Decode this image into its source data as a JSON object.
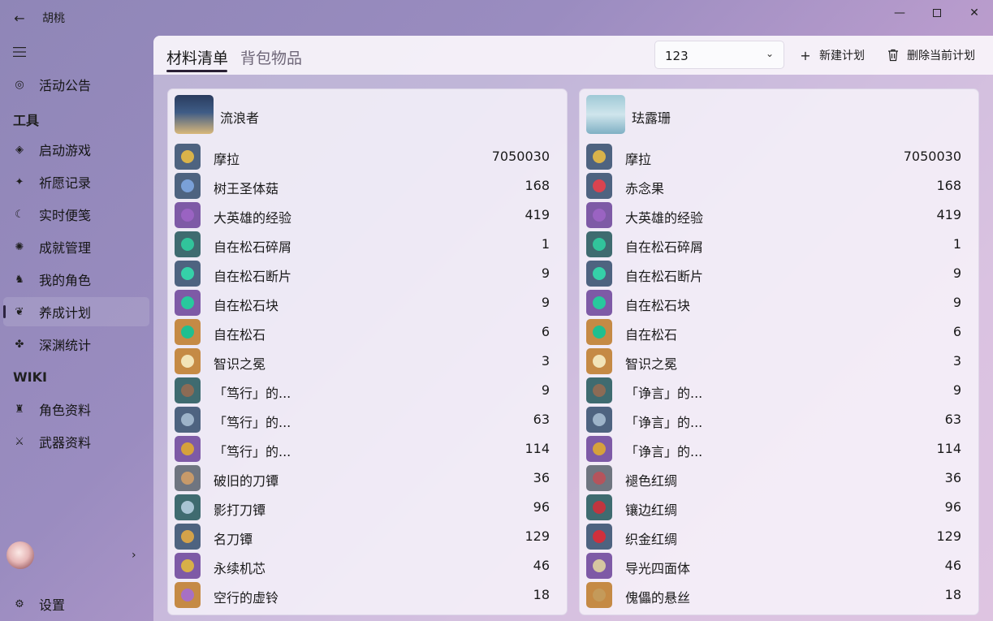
{
  "window": {
    "title": "胡桃"
  },
  "sidebar": {
    "items": [
      {
        "id": "announcement",
        "label": "活动公告",
        "icon": "announcement-icon",
        "glyph": "◎"
      },
      {
        "id": "launch",
        "label": "启动游戏",
        "icon": "launch-game-icon",
        "glyph": "◈"
      },
      {
        "id": "wish",
        "label": "祈愿记录",
        "icon": "wish-icon",
        "glyph": "✦"
      },
      {
        "id": "notes",
        "label": "实时便笺",
        "icon": "moon-icon",
        "glyph": "☾"
      },
      {
        "id": "achievement",
        "label": "成就管理",
        "icon": "achievement-icon",
        "glyph": "✺"
      },
      {
        "id": "avatars",
        "label": "我的角色",
        "icon": "avatar-icon",
        "glyph": "♞"
      },
      {
        "id": "cultivation",
        "label": "养成计划",
        "icon": "cultivation-icon",
        "glyph": "❦"
      },
      {
        "id": "abyss",
        "label": "深渊统计",
        "icon": "abyss-icon",
        "glyph": "✤"
      },
      {
        "id": "wiki-avatar",
        "label": "角色资料",
        "icon": "wiki-avatar-icon",
        "glyph": "♜"
      },
      {
        "id": "wiki-weapon",
        "label": "武器资料",
        "icon": "weapon-icon",
        "glyph": "⚔"
      }
    ],
    "headers": {
      "tools": "工具",
      "wiki": "WIKI"
    },
    "settings_label": "设置",
    "active": "cultivation"
  },
  "tabs": [
    {
      "label": "材料清单",
      "active": true
    },
    {
      "label": "背包物品",
      "active": false
    }
  ],
  "plan_select": {
    "value": "123"
  },
  "commands": {
    "new_plan": "新建计划",
    "delete_plan": "删除当前计划"
  },
  "cards": [
    {
      "character": "流浪者",
      "materials": [
        {
          "name": "摩拉",
          "count": "7050030",
          "color": "#d9b34a",
          "bg": "#4e6380"
        },
        {
          "name": "树王圣体菇",
          "count": "168",
          "color": "#7aa0d8",
          "bg": "#4e6380"
        },
        {
          "name": "大英雄的经验",
          "count": "419",
          "color": "#9a63c2",
          "bg": "#7e5aa6"
        },
        {
          "name": "自在松石碎屑",
          "count": "1",
          "color": "#31c49b",
          "bg": "#3f6b70"
        },
        {
          "name": "自在松石断片",
          "count": "9",
          "color": "#35d1a8",
          "bg": "#4e6380"
        },
        {
          "name": "自在松石块",
          "count": "9",
          "color": "#28c99d",
          "bg": "#7e5aa6"
        },
        {
          "name": "自在松石",
          "count": "6",
          "color": "#1fbf8f",
          "bg": "#c58a45"
        },
        {
          "name": "智识之冕",
          "count": "3",
          "color": "#f2e4b8",
          "bg": "#c58a45"
        },
        {
          "name": "「笃行」的...",
          "count": "9",
          "color": "#8c6b55",
          "bg": "#3f6b70"
        },
        {
          "name": "「笃行」的...",
          "count": "63",
          "color": "#9db3c9",
          "bg": "#4e6380"
        },
        {
          "name": "「笃行」的...",
          "count": "114",
          "color": "#d6a13c",
          "bg": "#7e5aa6"
        },
        {
          "name": "破旧的刀镡",
          "count": "36",
          "color": "#c79a6a",
          "bg": "#6f7580"
        },
        {
          "name": "影打刀镡",
          "count": "96",
          "color": "#a8c4d4",
          "bg": "#3f6b70"
        },
        {
          "name": "名刀镡",
          "count": "129",
          "color": "#d3a24a",
          "bg": "#4e6380"
        },
        {
          "name": "永续机芯",
          "count": "46",
          "color": "#d8b048",
          "bg": "#7e5aa6"
        },
        {
          "name": "空行的虚铃",
          "count": "18",
          "color": "#a770c4",
          "bg": "#c58a45"
        }
      ]
    },
    {
      "character": "珐露珊",
      "materials": [
        {
          "name": "摩拉",
          "count": "7050030",
          "color": "#d9b34a",
          "bg": "#4e6380"
        },
        {
          "name": "赤念果",
          "count": "168",
          "color": "#d9434f",
          "bg": "#4e6380"
        },
        {
          "name": "大英雄的经验",
          "count": "419",
          "color": "#9a63c2",
          "bg": "#7e5aa6"
        },
        {
          "name": "自在松石碎屑",
          "count": "1",
          "color": "#31c49b",
          "bg": "#3f6b70"
        },
        {
          "name": "自在松石断片",
          "count": "9",
          "color": "#35d1a8",
          "bg": "#4e6380"
        },
        {
          "name": "自在松石块",
          "count": "9",
          "color": "#28c99d",
          "bg": "#7e5aa6"
        },
        {
          "name": "自在松石",
          "count": "6",
          "color": "#1fbf8f",
          "bg": "#c58a45"
        },
        {
          "name": "智识之冕",
          "count": "3",
          "color": "#f2e4b8",
          "bg": "#c58a45"
        },
        {
          "name": "「诤言」的...",
          "count": "9",
          "color": "#8c6b55",
          "bg": "#3f6b70"
        },
        {
          "name": "「诤言」的...",
          "count": "63",
          "color": "#9db3c9",
          "bg": "#4e6380"
        },
        {
          "name": "「诤言」的...",
          "count": "114",
          "color": "#d6a13c",
          "bg": "#7e5aa6"
        },
        {
          "name": "褪色红绸",
          "count": "36",
          "color": "#b5545c",
          "bg": "#6f7580"
        },
        {
          "name": "镶边红绸",
          "count": "96",
          "color": "#c1353f",
          "bg": "#3f6b70"
        },
        {
          "name": "织金红绸",
          "count": "129",
          "color": "#d0303c",
          "bg": "#4e6380"
        },
        {
          "name": "导光四面体",
          "count": "46",
          "color": "#d6c7a0",
          "bg": "#7e5aa6"
        },
        {
          "name": "傀儡的悬丝",
          "count": "18",
          "color": "#c49a5a",
          "bg": "#c58a45"
        }
      ]
    }
  ]
}
